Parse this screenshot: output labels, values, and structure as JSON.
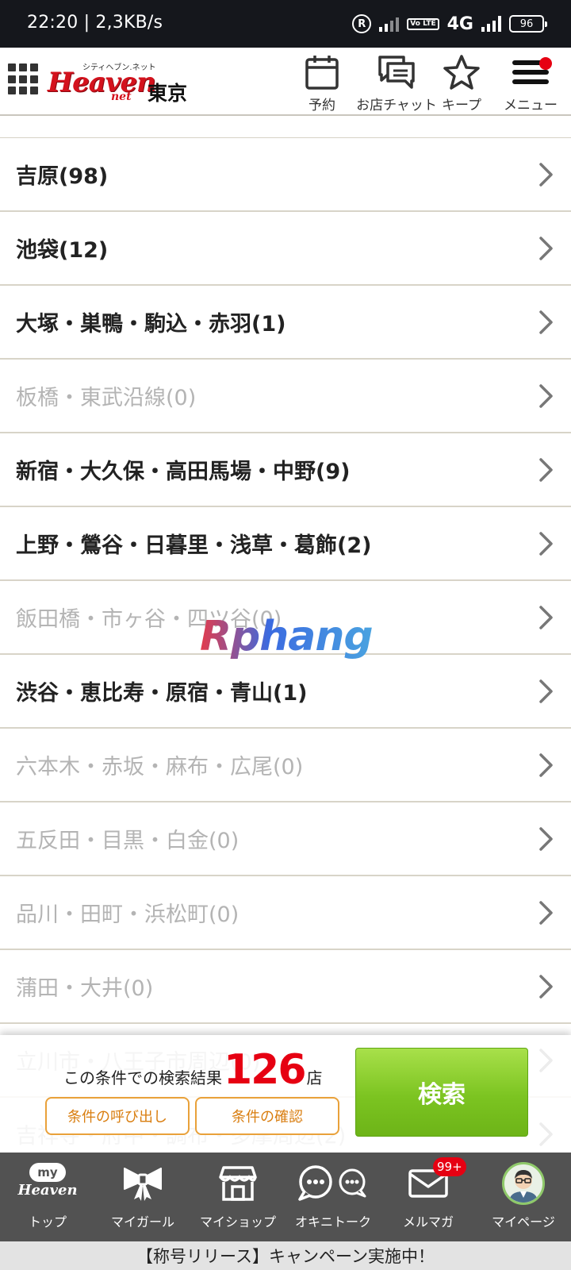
{
  "status_bar": {
    "time_speed": "22:20 | 2,3KB/s",
    "reg_icon": "R",
    "volte": "Vo LTE",
    "network": "4G",
    "battery": "96"
  },
  "header": {
    "region": "東京",
    "logo_top": "シティヘブン.ネット",
    "logo_main": "Heaven",
    "logo_net": "net",
    "buttons": {
      "reserve": "予約",
      "chat": "お店チャット",
      "keep": "キープ",
      "menu": "メニュー"
    }
  },
  "areas": [
    {
      "label": "吉原(98)",
      "active": true
    },
    {
      "label": "池袋(12)",
      "active": true
    },
    {
      "label": "大塚・巣鴨・駒込・赤羽(1)",
      "active": true
    },
    {
      "label": "板橋・東武沿線(0)",
      "active": false
    },
    {
      "label": "新宿・大久保・高田馬場・中野(9)",
      "active": true
    },
    {
      "label": "上野・鶯谷・日暮里・浅草・葛飾(2)",
      "active": true
    },
    {
      "label": "飯田橋・市ヶ谷・四ツ谷(0)",
      "active": false
    },
    {
      "label": "渋谷・恵比寿・原宿・青山(1)",
      "active": true
    },
    {
      "label": "六本木・赤坂・麻布・広尾(0)",
      "active": false
    },
    {
      "label": "五反田・目黒・白金(0)",
      "active": false
    },
    {
      "label": "品川・田町・浜松町(0)",
      "active": false
    },
    {
      "label": "蒲田・大井(0)",
      "active": false
    },
    {
      "label": "立川市・八王子市周辺(0)",
      "active": false
    },
    {
      "label": "吉祥寺・府中・調布・多摩周辺(2)",
      "active": false
    }
  ],
  "watermark": "Rphang",
  "search": {
    "result_label": "この条件での検索結果",
    "result_count": "126",
    "result_unit": "店",
    "recall_label": "条件の呼び出し",
    "check_label": "条件の確認",
    "search_label": "検索"
  },
  "bottom_nav": [
    {
      "name": "top",
      "label": "トップ",
      "icon": "my-heaven-logo"
    },
    {
      "name": "my-girl",
      "label": "マイガール",
      "icon": "ribbon-icon"
    },
    {
      "name": "my-shop",
      "label": "マイショップ",
      "icon": "shop-icon"
    },
    {
      "name": "okini-talk",
      "label": "オキニトーク",
      "icon": "chat-bubbles-icon"
    },
    {
      "name": "mail-magazine",
      "label": "メルマガ",
      "icon": "mail-icon",
      "badge": "99+"
    },
    {
      "name": "my-page",
      "label": "マイページ",
      "icon": "avatar"
    }
  ],
  "my_logo": {
    "bubble": "my",
    "text": "Heaven"
  },
  "campaign": "【称号リリース】キャンペーン実施中！",
  "colors": {
    "accent_red": "#e60012",
    "search_green": "#7cc421",
    "cond_orange": "#e9a13a",
    "nav_bg": "#525252"
  }
}
